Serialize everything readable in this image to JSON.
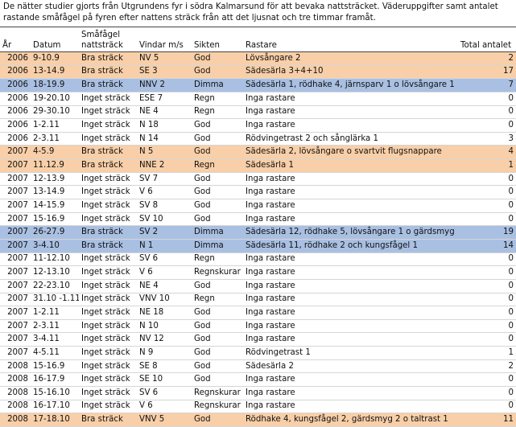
{
  "intro": "De nätter studier gjorts från Utgrundens fyr i södra Kalmarsund för att bevaka nattsträcket. Väderuppgifter samt antalet\nrastande småfågel på fyren efter nattens sträck från att det ljusnat och tre timmar framåt.",
  "headers": {
    "year": "År",
    "date": "Datum",
    "nattstrack": "Småfågel\nnattsträck",
    "wind": "Vindar m/s",
    "sight": "Sikten",
    "rastare": "Rastare",
    "total": "Total antalet"
  },
  "colors": {
    "highlight_orange": "#f8cfa8",
    "highlight_blue": "#a9c0e2"
  },
  "rows": [
    {
      "year": "2006",
      "date": "9-10.9",
      "nat": "Bra sträck",
      "wind": "NV 5",
      "sight": "God",
      "rastare": "Lövsångare 2",
      "total": "2",
      "hl": "orange"
    },
    {
      "year": "2006",
      "date": "13-14.9",
      "nat": "Bra sträck",
      "wind": "SE 3",
      "sight": "God",
      "rastare": "Sädesärla 3+4+10",
      "total": "17",
      "hl": "orange"
    },
    {
      "year": "2006",
      "date": "18-19.9",
      "nat": "Bra sträck",
      "wind": "NNV 2",
      "sight": "Dimma",
      "rastare": "Sädesärla 1, rödhake 4, järnsparv 1 o lövsångare 1",
      "total": "7",
      "hl": "blue"
    },
    {
      "year": "2006",
      "date": "19-20.10",
      "nat": "Inget sträck",
      "wind": "ESE 7",
      "sight": "Regn",
      "rastare": "Inga rastare",
      "total": "0",
      "hl": ""
    },
    {
      "year": "2006",
      "date": "29-30.10",
      "nat": "Inget sträck",
      "wind": "NE 4",
      "sight": "Regn",
      "rastare": "Inga rastare",
      "total": "0",
      "hl": ""
    },
    {
      "year": "2006",
      "date": "1-2.11",
      "nat": "Inget sträck",
      "wind": "N 18",
      "sight": "God",
      "rastare": "Inga rastare",
      "total": "0",
      "hl": ""
    },
    {
      "year": "2006",
      "date": "2-3.11",
      "nat": "Inget sträck",
      "wind": "N 14",
      "sight": "God",
      "rastare": "Rödvingetrast 2 och sånglärka 1",
      "total": "3",
      "hl": ""
    },
    {
      "year": "2007",
      "date": "4-5.9",
      "nat": "Bra sträck",
      "wind": "N 5",
      "sight": "God",
      "rastare": "Sädesärla 2, lövsångare o svartvit flugsnappare",
      "total": "4",
      "hl": "orange"
    },
    {
      "year": "2007",
      "date": "11.12.9",
      "nat": "Bra sträck",
      "wind": "NNE 2",
      "sight": "Regn",
      "rastare": "Sädesärla 1",
      "total": "1",
      "hl": "orange"
    },
    {
      "year": "2007",
      "date": "12-13.9",
      "nat": "Inget sträck",
      "wind": "SV 7",
      "sight": "God",
      "rastare": "Inga rastare",
      "total": "0",
      "hl": ""
    },
    {
      "year": "2007",
      "date": "13-14.9",
      "nat": "Inget sträck",
      "wind": "V 6",
      "sight": "God",
      "rastare": "Inga rastare",
      "total": "0",
      "hl": ""
    },
    {
      "year": "2007",
      "date": "14-15.9",
      "nat": "Inget sträck",
      "wind": "SV 8",
      "sight": "God",
      "rastare": "Inga rastare",
      "total": "0",
      "hl": ""
    },
    {
      "year": "2007",
      "date": "15-16.9",
      "nat": "Inget sträck",
      "wind": "SV 10",
      "sight": "God",
      "rastare": "Inga rastare",
      "total": "0",
      "hl": ""
    },
    {
      "year": "2007",
      "date": "26-27.9",
      "nat": "Bra sträck",
      "wind": "SV 2",
      "sight": "Dimma",
      "rastare": "Sädesärla 12, rödhake 5, lövsångare 1 o gärdsmyg 1",
      "total": "19",
      "hl": "blue"
    },
    {
      "year": "2007",
      "date": "3-4.10",
      "nat": "Bra sträck",
      "wind": "N 1",
      "sight": "Dimma",
      "rastare": "Sädesärla 11, rödhake 2 och kungsfågel 1",
      "total": "14",
      "hl": "blue"
    },
    {
      "year": "2007",
      "date": "11-12.10",
      "nat": "Inget sträck",
      "wind": "SV 6",
      "sight": "Regn",
      "rastare": "Inga rastare",
      "total": "0",
      "hl": ""
    },
    {
      "year": "2007",
      "date": "12-13.10",
      "nat": "Inget sträck",
      "wind": "V 6",
      "sight": "Regnskurar",
      "rastare": "Inga rastare",
      "total": "0",
      "hl": ""
    },
    {
      "year": "2007",
      "date": "22-23.10",
      "nat": "Inget sträck",
      "wind": "NE 4",
      "sight": "God",
      "rastare": "Inga rastare",
      "total": "0",
      "hl": ""
    },
    {
      "year": "2007",
      "date": "31.10 -1.11",
      "nat": "Inget sträck",
      "wind": "VNV 10",
      "sight": "Regn",
      "rastare": "Inga rastare",
      "total": "0",
      "hl": ""
    },
    {
      "year": "2007",
      "date": "1-2.11",
      "nat": "Inget sträck",
      "wind": "NE 18",
      "sight": "God",
      "rastare": "Inga rastare",
      "total": "0",
      "hl": ""
    },
    {
      "year": "2007",
      "date": "2-3.11",
      "nat": "Inget sträck",
      "wind": "N 10",
      "sight": "God",
      "rastare": "Inga rastare",
      "total": "0",
      "hl": ""
    },
    {
      "year": "2007",
      "date": "3-4.11",
      "nat": "Inget sträck",
      "wind": "NV 12",
      "sight": "God",
      "rastare": "Inga rastare",
      "total": "0",
      "hl": ""
    },
    {
      "year": "2007",
      "date": "4-5.11",
      "nat": "Inget sträck",
      "wind": "N 9",
      "sight": "God",
      "rastare": "Rödvingetrast 1",
      "total": "1",
      "hl": ""
    },
    {
      "year": "2008",
      "date": "15-16.9",
      "nat": "Inget sträck",
      "wind": "SE 8",
      "sight": "God",
      "rastare": "Sädesärla 2",
      "total": "2",
      "hl": ""
    },
    {
      "year": "2008",
      "date": "16-17.9",
      "nat": "Inget sträck",
      "wind": "SE 10",
      "sight": "God",
      "rastare": "Inga rastare",
      "total": "0",
      "hl": ""
    },
    {
      "year": "2008",
      "date": "15-16.10",
      "nat": "Inget sträck",
      "wind": "SV 6",
      "sight": "Regnskurar",
      "rastare": "Inga rastare",
      "total": "0",
      "hl": ""
    },
    {
      "year": "2008",
      "date": "16-17.10",
      "nat": "Inget sträck",
      "wind": "V 6",
      "sight": "Regnskurar",
      "rastare": "Inga rastare",
      "total": "0",
      "hl": ""
    },
    {
      "year": "2008",
      "date": "17-18.10",
      "nat": "Bra sträck",
      "wind": "VNV 5",
      "sight": "God",
      "rastare": "Rödhake 4, kungsfågel 2, gärdsmyg 2 o taltrast 1",
      "total": "11",
      "hl": "orange"
    }
  ]
}
